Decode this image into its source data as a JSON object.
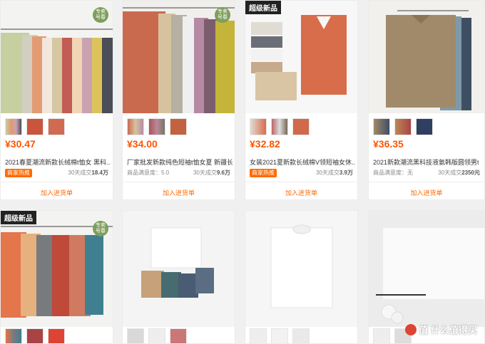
{
  "products": [
    {
      "price": "¥30.47",
      "title": "2021春夏潮流新款长绒棉t恤女 黑科...",
      "badge": "商家热推",
      "sales": "30天成交",
      "sales_value": "18.4万",
      "satisfaction": "",
      "tag": "",
      "round_tag": "专卖\n号春",
      "add_label": "加入进货单"
    },
    {
      "price": "¥34.00",
      "title": "厂家批发新款纯色短袖t恤女夏 新疆长...",
      "badge": "",
      "satisfaction": "商品满意度：5.0",
      "sales": "30天成交",
      "sales_value": "9.6万",
      "tag": "",
      "round_tag": "专卖\n号春",
      "add_label": "加入进货单"
    },
    {
      "price": "¥32.82",
      "title": "女装2021夏新款长绒棉V领短袖女休...",
      "badge": "商家热推",
      "satisfaction": "",
      "sales": "30天成交",
      "sales_value": "3.9万",
      "tag": "超级新品",
      "round_tag": "",
      "add_label": "加入进货单"
    },
    {
      "price": "¥36.35",
      "title": "2021新款潮流黑科技液氨韩版圆领男t...",
      "badge": "",
      "satisfaction": "商品满意度：无",
      "sales": "30天成交",
      "sales_value": "2350元",
      "tag": "",
      "round_tag": "",
      "add_label": "加入进货单"
    }
  ],
  "row2": [
    {
      "tag": "超级新品",
      "round_tag": "专卖\n号春"
    },
    {
      "tag": "",
      "round_tag": ""
    },
    {
      "tag": "",
      "round_tag": ""
    },
    {
      "tag": "",
      "round_tag": ""
    }
  ],
  "watermark": "值 什么值得买",
  "colors": {
    "accent": "#ff5500",
    "badge": "#ff6a00"
  }
}
